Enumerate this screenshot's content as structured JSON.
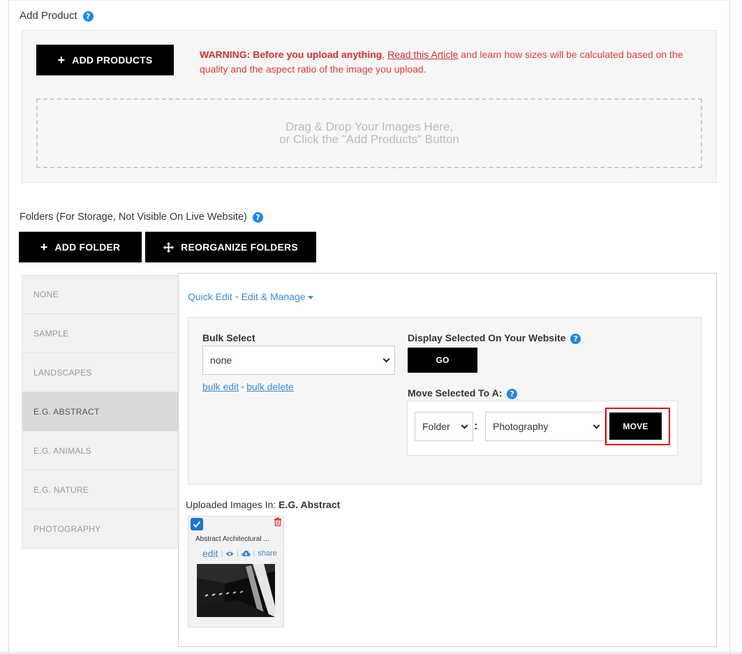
{
  "add_product": {
    "title": "Add Product",
    "add_button": "ADD PRODUCTS",
    "warning_bold": "WARNING: Before you upload anything",
    "warning_link": "Read this Article",
    "warning_rest": " and learn how sizes will be calculated based on the quality and the aspect ratio of the image you upload.",
    "dropzone_line1": "Drag & Drop Your Images Here,",
    "dropzone_line2": "or Click the \"Add Products\" Button"
  },
  "folders": {
    "title": "Folders (For Storage, Not Visible On Live Website)",
    "add_button": "ADD FOLDER",
    "reorganize_button": "REORGANIZE FOLDERS",
    "items": [
      {
        "label": "NONE"
      },
      {
        "label": "SAMPLE"
      },
      {
        "label": "LANDSCAPES"
      },
      {
        "label": "E.G. ABSTRACT"
      },
      {
        "label": "E.G. ANIMALS"
      },
      {
        "label": "E.G. NATURE"
      },
      {
        "label": "PHOTOGRAPHY"
      }
    ],
    "active_index": 3
  },
  "manage": {
    "quick_edit": "Quick Edit",
    "edit_manage": "Edit & Manage",
    "bulk_select_label": "Bulk Select",
    "bulk_select_value": "none",
    "bulk_edit": "bulk edit",
    "bulk_delete": "bulk delete",
    "display_label": "Display Selected On Your Website",
    "go_button": "GO",
    "move_label": "Move Selected To A:",
    "move_type_value": "Folder",
    "move_target_value": "Photography",
    "move_button": "MOVE"
  },
  "uploaded": {
    "prefix": "Uploaded Images In: ",
    "folder": "E.G. Abstract",
    "card_title": "Abstract Architectural ...",
    "edit": "edit",
    "share": "share",
    "checked": true
  },
  "colors": {
    "accent": "#3a8bd6",
    "warning": "#e53935",
    "highlight": "#ee0000"
  }
}
